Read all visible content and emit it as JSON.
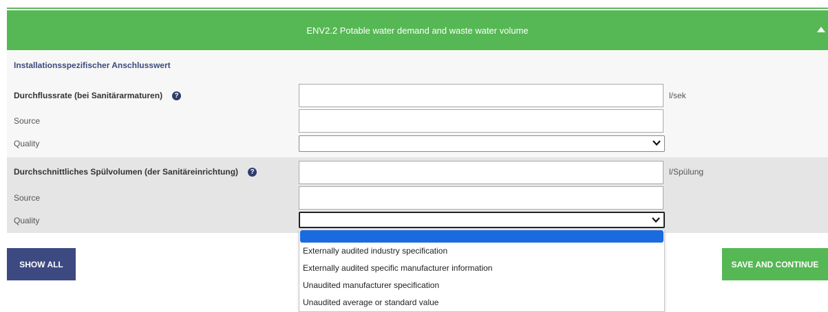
{
  "header": {
    "title": "ENV2.2 Potable water demand and waste water volume",
    "collapse_icon": "triangle-up-icon"
  },
  "form": {
    "section_heading": "Installationsspezifischer Anschlusswert",
    "group1": {
      "label": "Durchflussrate (bei Sanitärarmaturen)",
      "help_icon": "question-mark-icon",
      "value": "",
      "unit": "l/sek",
      "source_label": "Source",
      "source_value": "",
      "quality_label": "Quality",
      "quality_value": ""
    },
    "group2": {
      "label": "Durchschnittliches Spülvolumen (der Sanitäreinrichtung)",
      "help_icon": "question-mark-icon",
      "value": "",
      "unit": "l/Spülung",
      "source_label": "Source",
      "source_value": "",
      "quality_label": "Quality",
      "quality_value": ""
    }
  },
  "quality_options": [
    "",
    "Externally audited industry specification",
    "Externally audited specific manufacturer information",
    "Unaudited manufacturer specification",
    "Unaudited average or standard value"
  ],
  "buttons": {
    "show_all": "SHOW ALL",
    "save_and_continue": "SAVE AND CONTINUE"
  },
  "colors": {
    "header_green": "#56b854",
    "button_navy": "#3d4a82",
    "heading_navy": "#3a4b7c",
    "selected_option": "#1a6be0"
  }
}
